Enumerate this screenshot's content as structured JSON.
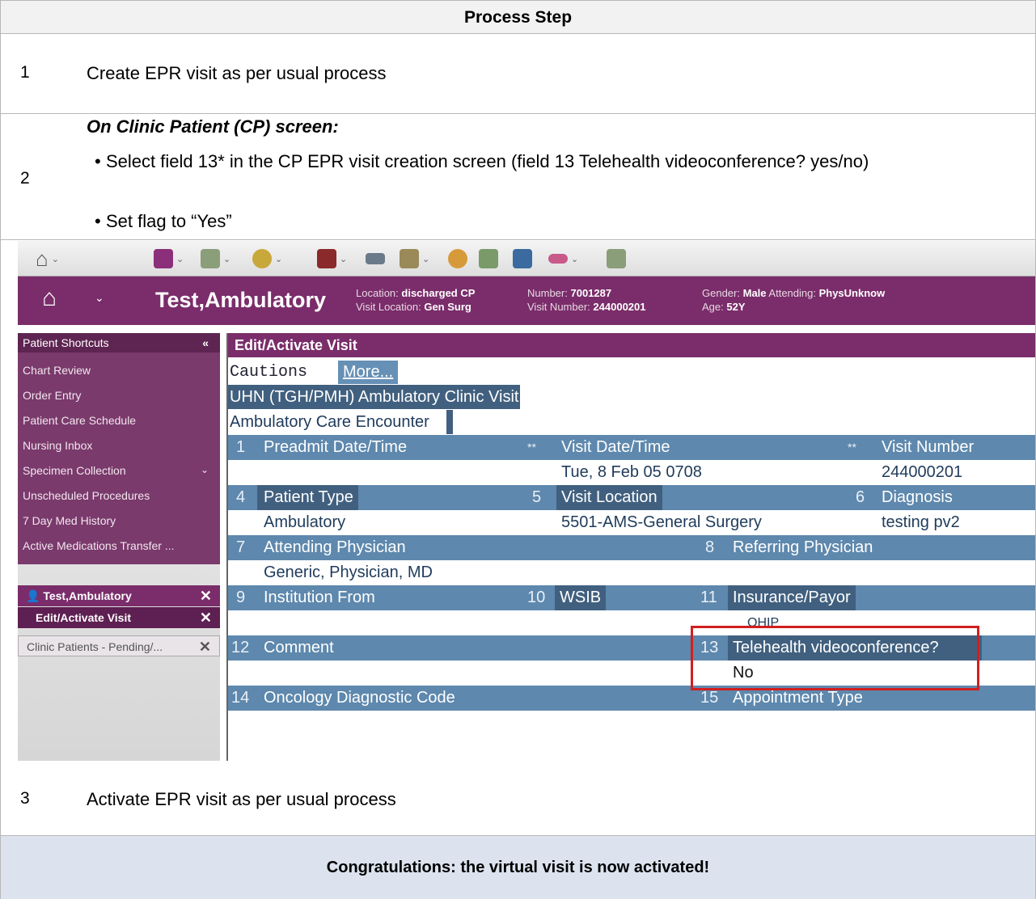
{
  "document": {
    "header": "Process Step",
    "step1": {
      "num": "1",
      "text": "Create EPR visit as per usual process"
    },
    "step2": {
      "num": "2",
      "title": "On Clinic Patient (CP) screen:",
      "bullet1": "Select field 13* in the CP EPR visit creation screen (field 13 Telehealth videoconference? yes/no)",
      "bullet2": "Set flag to “Yes”"
    },
    "step3": {
      "num": "3",
      "text": "Activate EPR visit as per usual process"
    },
    "congrats": "Congratulations: the virtual visit is now activated!"
  },
  "screenshot": {
    "patient_name": "Test,Ambulatory",
    "info": {
      "location_label": "Location:",
      "location": "discharged CP",
      "visit_location_label": "Visit Location:",
      "visit_location": "Gen Surg",
      "number_label": "Number:",
      "number": "7001287",
      "visit_number_label": "Visit Number:",
      "visit_number": "244000201",
      "gender_label": "Gender:",
      "gender": "Male",
      "age_label": "Age:",
      "age": "52Y",
      "attending_label": "Attending:",
      "attending": "PhysUnknow"
    },
    "sidebar": {
      "header": "Patient Shortcuts",
      "items": [
        "Chart Review",
        "Order Entry",
        "Patient Care Schedule",
        "Nursing Inbox",
        "Specimen Collection",
        "Unscheduled Procedures",
        "7 Day Med History",
        "Active Medications Transfer ..."
      ],
      "tab_patient": "Test,Ambulatory",
      "tab_edit": "Edit/Activate Visit",
      "tab_clinic": "Clinic Patients - Pending/..."
    },
    "form": {
      "title": "Edit/Activate Visit",
      "cautions": "Cautions",
      "more": "More...",
      "visit_type": "UHN (TGH/PMH) Ambulatory Clinic Visit",
      "encounter": "Ambulatory Care Encounter",
      "f1_num": "1",
      "f1": "Preadmit Date/Time",
      "req1": "**",
      "f2": "Visit Date/Time",
      "req2": "**",
      "f3": "Visit Number",
      "v2": "Tue, 8 Feb 05  0708",
      "v3": "244000201",
      "f4_num": "4",
      "f4": "Patient Type",
      "f5_num": "5",
      "f5": "Visit Location",
      "f6_num": "6",
      "f6": "Diagnosis",
      "v4": "Ambulatory",
      "v5": "5501-AMS-General Surgery",
      "v6": "testing pv2",
      "f7_num": "7",
      "f7": "Attending Physician",
      "f8_num": "8",
      "f8": "Referring Physician",
      "v7": "Generic, Physician, MD",
      "f9_num": "9",
      "f9": "Institution From",
      "f10_num": "10",
      "f10": "WSIB",
      "f11_num": "11",
      "f11": "Insurance/Payor",
      "v11": "OHIP",
      "f12_num": "12",
      "f12": "Comment",
      "f13_num": "13",
      "f13": "Telehealth videoconference?",
      "v13": "No",
      "f14_num": "14",
      "f14": "Oncology Diagnostic Code",
      "f15_num": "15",
      "f15": "Appointment Type"
    }
  }
}
